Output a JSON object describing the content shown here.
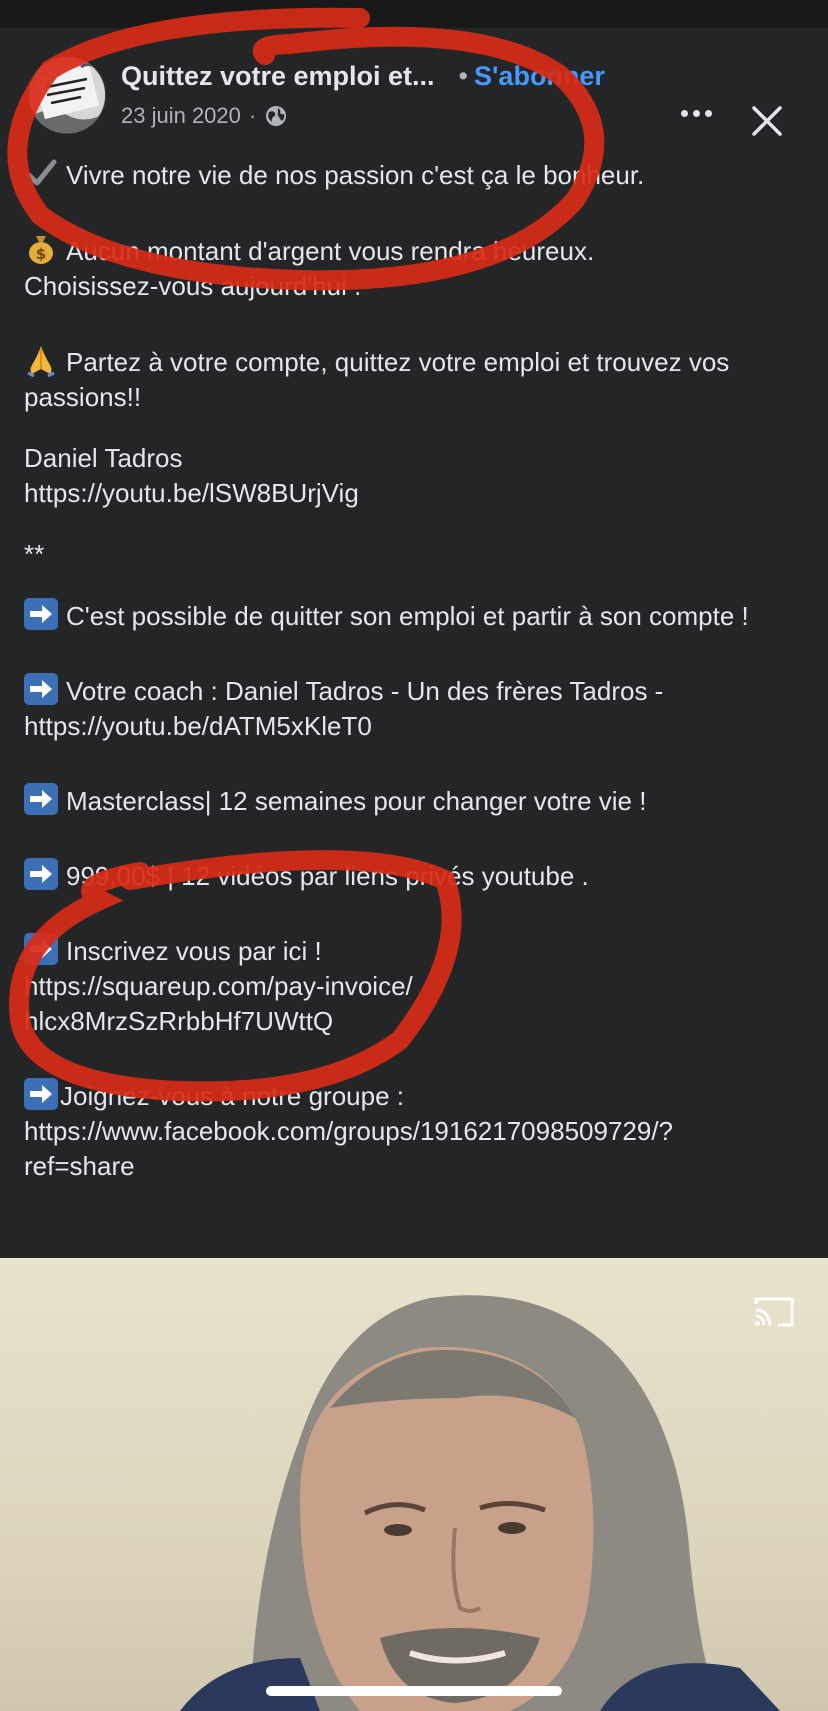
{
  "header": {
    "author_name": "Quittez votre emploi et...",
    "dot": "•",
    "follow_label": "S'abonner",
    "date": "23 juin 2020",
    "meta_sep": "·",
    "privacy_icon": "globe-icon",
    "more_icon": "more-horizontal-icon",
    "close_icon": "close-icon"
  },
  "avatar": {
    "sign_text": "JE REFUSE UN MONDE COMME ÇA !"
  },
  "post": {
    "p1": "Vivre notre vie de nos passion c'est ça le bonheur.",
    "p2a": "Aucun montant d'argent vous rendra heureux.",
    "p2b": "Choisissez-vous aujourd'hui .",
    "p3": "Partez à votre compte, quittez votre emploi et trouvez vos passions!!",
    "p4a": "Daniel Tadros",
    "p4b": "https://youtu.be/lSW8BUrjVig",
    "p5": "**",
    "p6": "C'est possible  de quitter son emploi et partir à son compte !",
    "p7a": "Votre coach : Daniel Tadros - Un des frères Tadros -",
    "p7b": "https://youtu.be/dATM5xKleT0",
    "p8": "Masterclass| 12 semaines pour changer votre vie !",
    "p9": "999,00$ | 12 vidéos par liens privés youtube .",
    "p10a": "Inscrivez vous par ici !",
    "p10b": "https://squareup.com/pay-invoice/",
    "p10c": "hlcx8MrzSzRrbbHf7UWttQ",
    "p11a": "Joignez-vous à notre groupe :",
    "p11b": "https://www.facebook.com/groups/1916217098509729/?",
    "p11c": "ref=share"
  },
  "video": {
    "cast_icon": "cast-icon"
  },
  "colors": {
    "background": "#242526",
    "text": "#e4e6eb",
    "secondary_text": "#b0b3b8",
    "link_blue": "#4599ff",
    "annotation_red": "#d92b17"
  }
}
